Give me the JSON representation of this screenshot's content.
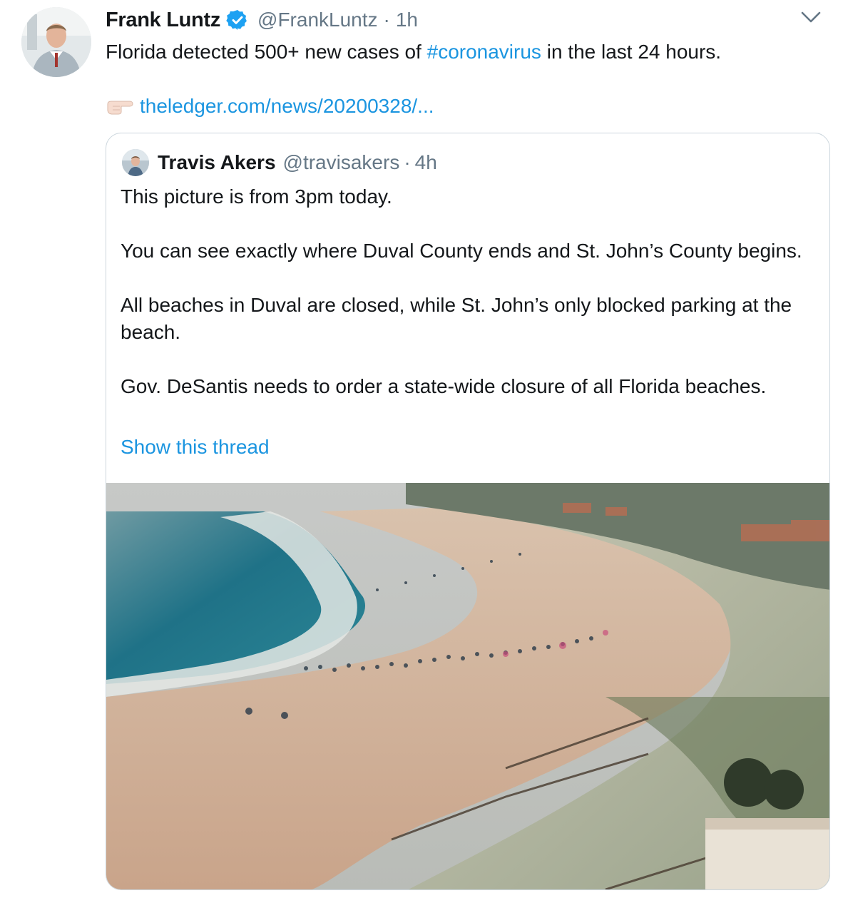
{
  "tweet": {
    "author_name": "Frank Luntz",
    "author_handle": "@FrankLuntz",
    "separator": "·",
    "time": "1h",
    "text_before": "Florida detected 500+ new cases of ",
    "hashtag": "#coronavirus",
    "text_after": " in the last 24 hours.",
    "link_text": "theledger.com/news/20200328/...",
    "link_emoji": "backhand-index-pointing-right",
    "verified": true
  },
  "quoted_tweet": {
    "author_name": "Travis Akers",
    "author_handle": "@travisakers",
    "separator": "·",
    "time": "4h",
    "paragraphs": [
      "This picture is from 3pm today.",
      "You can see exactly where Duval County ends and St. John’s County begins.",
      "All beaches in Duval are closed, while St. John’s only blocked parking at the beach.",
      "Gov. DeSantis needs to order a state-wide closure of all Florida beaches."
    ],
    "show_thread_label": "Show this thread",
    "image_description": "beach-aerial-photo"
  },
  "colors": {
    "link_blue": "#1b95e0",
    "muted_gray": "#657786",
    "border_gray": "#ccd6dd",
    "text": "#14171a"
  }
}
